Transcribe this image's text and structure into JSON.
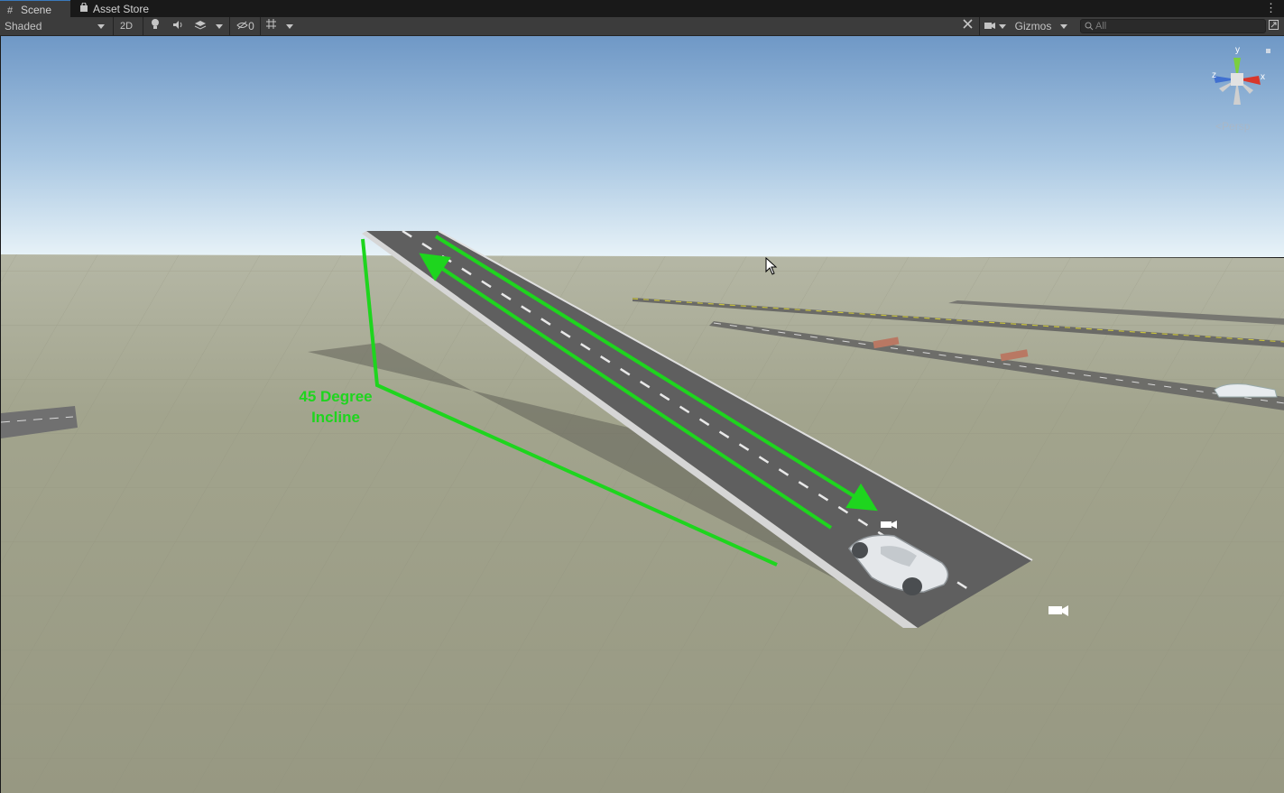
{
  "tabs": [
    {
      "label": "Scene",
      "icon": "grid-hash-icon"
    },
    {
      "label": "Asset Store",
      "icon": "shopping-bag-icon"
    }
  ],
  "toolbar": {
    "draw_mode": "Shaded",
    "mode_2d": "2D",
    "hidden_count": "0",
    "gizmos": "Gizmos",
    "search_placeholder": "All"
  },
  "scene": {
    "annotation_line1": "45 Degree",
    "annotation_line2": "Incline",
    "projection": "Persp",
    "gizmo_axes": [
      "y",
      "z",
      "x"
    ]
  },
  "colors": {
    "sky_top": "#6f98c6",
    "sky_horizon": "#e6f2f8",
    "ground": "#9c9d86",
    "road": "#6b6b6b",
    "annotation": "#1ed51e",
    "accent_tab": "#3a79bb"
  }
}
